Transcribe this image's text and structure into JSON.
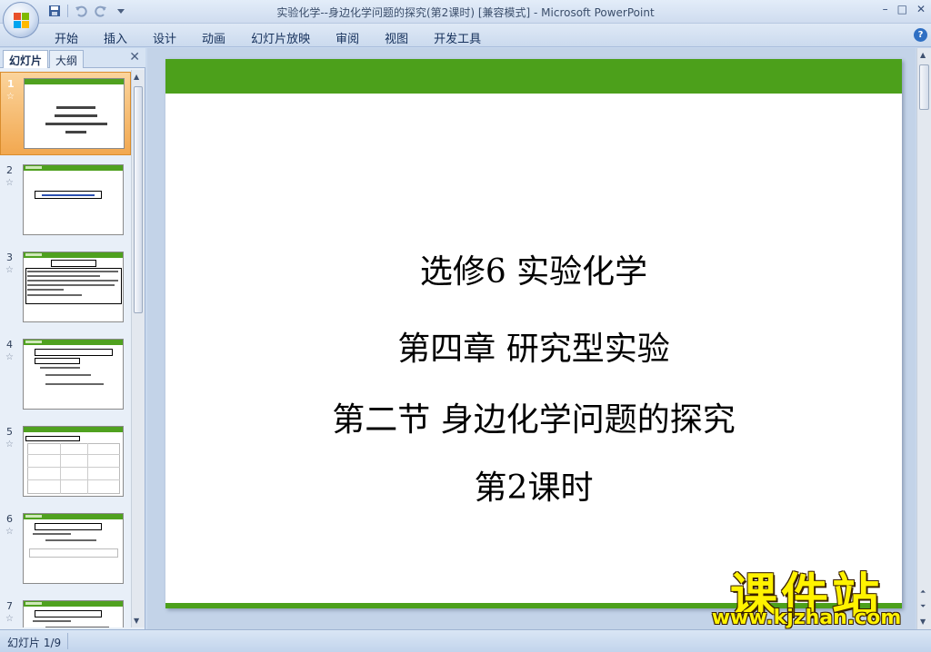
{
  "window": {
    "title_doc": "实验化学--身边化学问题的探究(第2课时) [兼容模式]",
    "title_sep": " - ",
    "title_app": "Microsoft PowerPoint",
    "min_glyph": "–",
    "max_glyph": "□",
    "close_glyph": "✕"
  },
  "qat": {
    "save_icon": "save-icon",
    "undo_icon": "undo-icon",
    "redo_icon": "redo-icon",
    "customize_icon": "customize-qat-icon"
  },
  "ribbon": {
    "tabs": [
      "开始",
      "插入",
      "设计",
      "动画",
      "幻灯片放映",
      "审阅",
      "视图",
      "开发工具"
    ],
    "help_glyph": "?"
  },
  "panel": {
    "tab_slides": "幻灯片",
    "tab_outline": "大纲",
    "close_glyph": "✕",
    "star_glyph": "☆",
    "thumb_numbers": [
      "1",
      "2",
      "3",
      "4",
      "5",
      "6",
      "7"
    ]
  },
  "slide": {
    "line1": "选修6  实验化学",
    "line2": "第四章  研究型实验",
    "line3": "第二节  身边化学问题的探究",
    "line4": "第2课时"
  },
  "watermark": {
    "big": "课件站",
    "small": "www.kjzhan.com"
  },
  "status": {
    "slide_info": "幻灯片 1/9"
  },
  "colors": {
    "accent_green": "#4ca01b",
    "selection": "#f2a850"
  }
}
